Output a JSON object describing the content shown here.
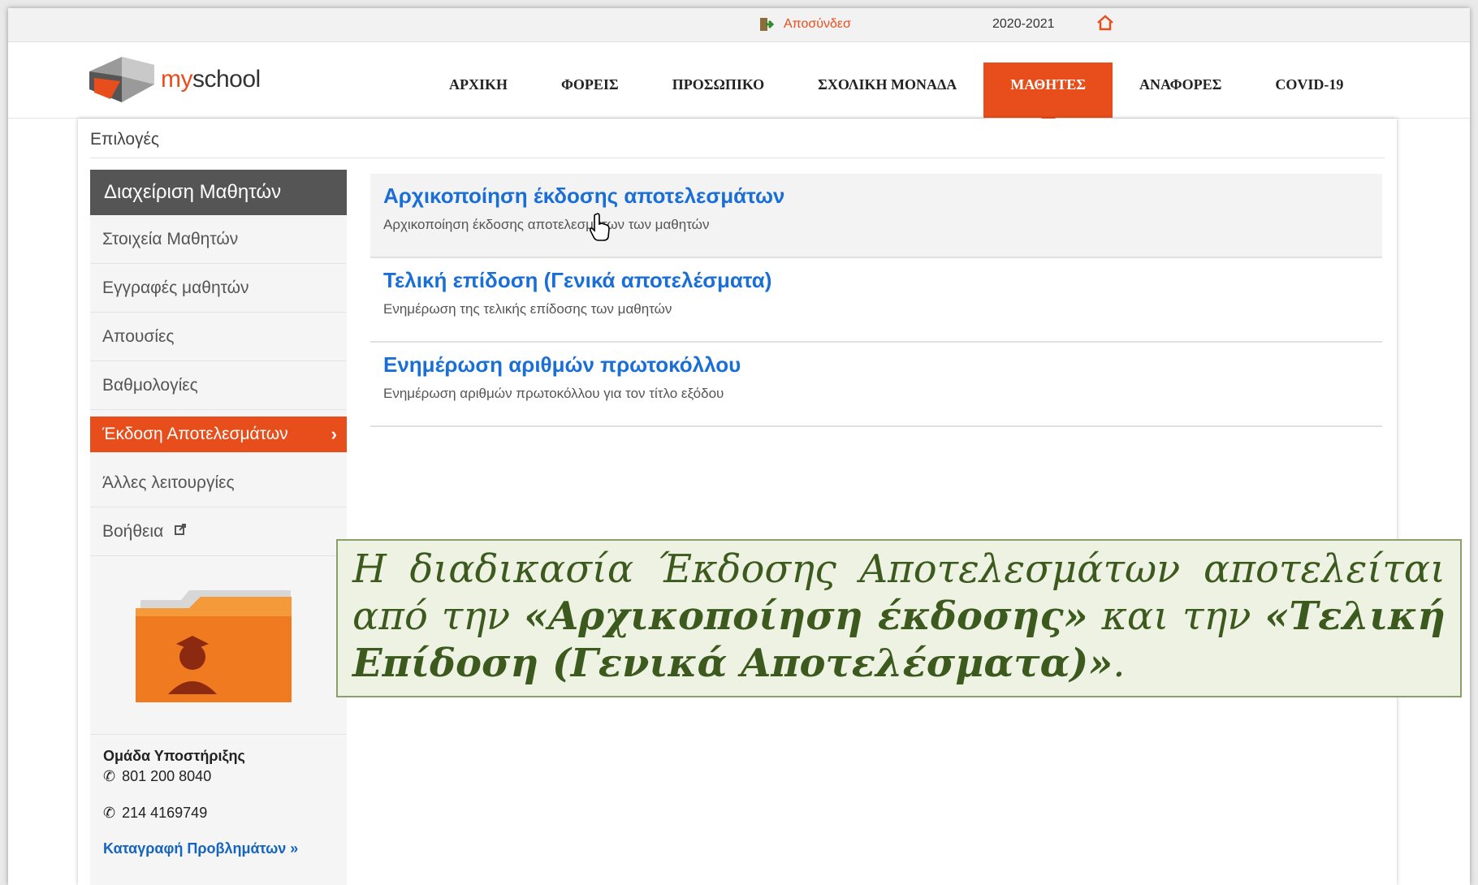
{
  "topbar": {
    "logout_label": "Αποσύνδεσ",
    "logout_user": "",
    "school_year": "2020-2021",
    "school_name": ""
  },
  "brand": {
    "prefix": "my",
    "suffix": "school"
  },
  "nav": {
    "items": [
      "ΑΡΧΙΚΗ",
      "ΦΟΡΕΙΣ",
      "ΠΡΟΣΩΠΙΚΟ",
      "ΣΧΟΛΙΚΗ ΜΟΝΑΔΑ",
      "ΜΑΘΗΤΕΣ",
      "ΑΝΑΦΟΡΕΣ",
      "COVID-19"
    ],
    "active": "ΜΑΘΗΤΕΣ"
  },
  "page": {
    "options_label": "Επιλογές"
  },
  "sidebar": {
    "title": "Διαχείριση Μαθητών",
    "items": [
      "Στοιχεία Μαθητών",
      "Εγγραφές μαθητών",
      "Απουσίες",
      "Βαθμολογίες",
      "Έκδοση Αποτελεσμάτων",
      "Άλλες λειτουργίες",
      "Βοήθεια"
    ],
    "active_item": "Έκδοση Αποτελεσμάτων"
  },
  "support": {
    "title": "Ομάδα Υποστήριξης",
    "phone1": "801 200 8040",
    "phone2": "214 4169749",
    "report_link": "Καταγραφή Προβλημάτων »"
  },
  "entries": [
    {
      "title": "Αρχικοποίηση έκδοσης αποτελεσμάτων",
      "desc": "Αρχικοποίηση έκδοσης αποτελεσμάτων των μαθητών"
    },
    {
      "title": "Τελική επίδοση (Γενικά αποτελέσματα)",
      "desc": "Ενημέρωση της τελικής επίδοσης των μαθητών"
    },
    {
      "title": "Ενημέρωση αριθμών πρωτοκόλλου",
      "desc": "Ενημέρωση αριθμών πρωτοκόλλου για τον τίτλο εξόδου"
    }
  ],
  "callout": {
    "part1": "Η διαδικασία Έκδοσης Αποτελεσμάτων αποτελείται από την ",
    "bold1": "«Αρχικοποίηση έκδοσης»",
    "part2": " και την ",
    "bold2": "«Τελική Επίδοση (Γενικά Αποτελέσματα)»",
    "part3": "."
  },
  "colors": {
    "accent": "#e84e1b",
    "link": "#1a6fd6",
    "sidebar_head": "#555555",
    "callout_bg": "#eef2e2",
    "callout_text": "#3d5a1e"
  }
}
